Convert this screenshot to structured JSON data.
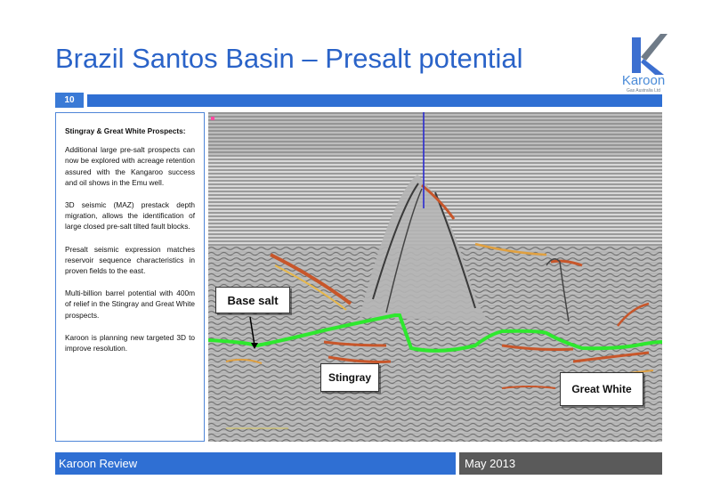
{
  "header": {
    "title": "Brazil Santos Basin – Presalt potential",
    "slide_number": "10"
  },
  "logo": {
    "name": "Karoon",
    "tagline": "Gas Australia Ltd"
  },
  "side_panel": {
    "heading": "Stingray & Great White Prospects:",
    "paragraphs": [
      "Additional large pre-salt prospects can now be explored with acreage retention assured with the Kangaroo success and oil shows in the Emu well.",
      "3D seismic (MAZ) prestack depth migration, allows the identification of large closed pre-salt tilted fault blocks.",
      "Presalt seismic expression matches reservoir sequence characteristics in proven fields to the east.",
      "Multi-billion barrel potential with 400m of relief in the Stingray and Great White prospects.",
      "Karoon is planning new targeted 3D to improve resolution."
    ]
  },
  "seismic_labels": {
    "base_salt": "Base salt",
    "stingray": "Stingray",
    "great_white": "Great White"
  },
  "footer": {
    "left": "Karoon Review",
    "right": "May 2013"
  },
  "colors": {
    "title_blue": "#2a63c8",
    "bar_blue": "#2f6fd3",
    "footer_grey": "#5a5a5a",
    "base_salt_line": "#2ee82e",
    "well_line": "#2b2bd0"
  }
}
